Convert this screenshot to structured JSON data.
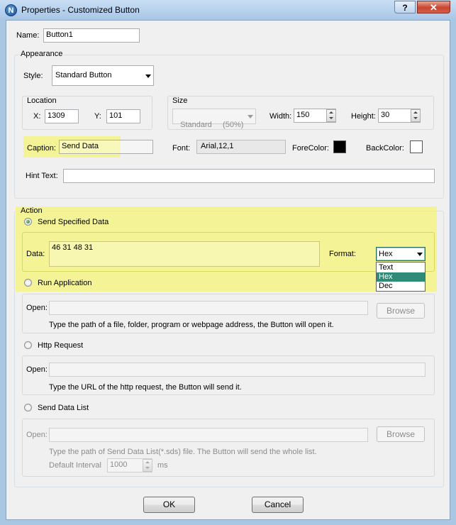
{
  "window": {
    "title": "Properties - Customized Button",
    "app_icon_letter": "N",
    "help_glyph": "?",
    "close_glyph": "✕"
  },
  "name": {
    "label": "Name:",
    "value": "Button1"
  },
  "appearance": {
    "legend": "Appearance",
    "style_label": "Style:",
    "style_value": "Standard Button",
    "location": {
      "legend": "Location",
      "x_label": "X:",
      "x_value": "1309",
      "y_label": "Y:",
      "y_value": "101"
    },
    "size": {
      "legend": "Size",
      "preset_value": "Standard     (50%)",
      "width_label": "Width:",
      "width_value": "150",
      "height_label": "Height:",
      "height_value": "30"
    },
    "caption_label": "Caption:",
    "caption_value": "Send Data",
    "font_label": "Font:",
    "font_value": "Arial,12,1",
    "forecolor_label": "ForeColor:",
    "forecolor": "#000000",
    "backcolor_label": "BackColor:",
    "backcolor": "#ffffff",
    "hint_label": "Hint Text:",
    "hint_value": ""
  },
  "action": {
    "legend": "Action",
    "send_specified": {
      "label": "Send Specified Data",
      "selected": true,
      "data_label": "Data:",
      "data_value": "46 31 48 31",
      "format_label": "Format:",
      "format_value": "Hex",
      "format_options": [
        "Text",
        "Hex",
        "Dec"
      ],
      "format_selected_index": 1
    },
    "run_application": {
      "label": "Run Application",
      "open_label": "Open:",
      "open_value": "",
      "browse_label": "Browse",
      "help": "Type the path of a file, folder, program or webpage address, the Button will open it."
    },
    "http_request": {
      "label": "Http Request",
      "open_label": "Open:",
      "open_value": "",
      "help": "Type the URL of the http request, the Button will send it."
    },
    "send_data_list": {
      "label": "Send Data List",
      "open_label": "Open:",
      "open_value": "",
      "browse_label": "Browse",
      "help": "Type the path of Send Data List(*.sds) file. The Button will send the whole list.",
      "interval_label": "Default Interval",
      "interval_value": "1000",
      "interval_unit": "ms"
    }
  },
  "footer": {
    "ok_label": "OK",
    "cancel_label": "Cancel"
  },
  "colors": {
    "highlight": "#f5f57a",
    "selection": "#2e8b77",
    "title_gradient_top": "#c9def4",
    "close_red": "#c8442e"
  }
}
